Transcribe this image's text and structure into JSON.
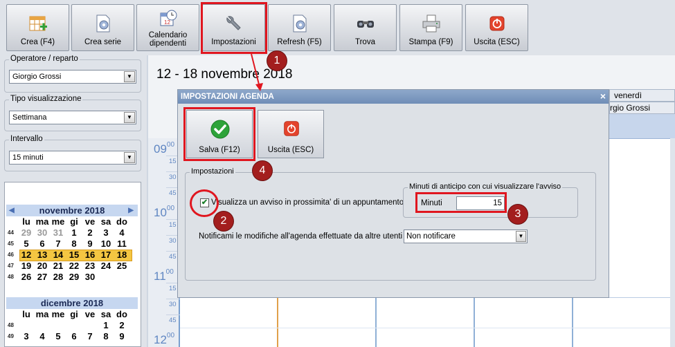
{
  "toolbar": {
    "buttons": [
      {
        "label": "Crea (F4)",
        "icon": "calendar-add-icon"
      },
      {
        "label": "Crea serie",
        "icon": "document-gear-icon"
      },
      {
        "label_line1": "Calendario",
        "label_line2": "dipendenti",
        "icon": "calendar-clock-icon"
      },
      {
        "label": "Impostazioni",
        "icon": "wrench-icon"
      },
      {
        "label": "Refresh (F5)",
        "icon": "document-gear-icon"
      },
      {
        "label": "Trova",
        "icon": "binoculars-icon"
      },
      {
        "label": "Stampa (F9)",
        "icon": "printer-icon"
      },
      {
        "label": "Uscita (ESC)",
        "icon": "power-icon"
      }
    ]
  },
  "left": {
    "operator_label": "Operatore / reparto",
    "operator_value": "Giorgio Grossi",
    "view_label": "Tipo visualizzazione",
    "view_value": "Settimana",
    "interval_label": "Intervallo",
    "interval_value": "15 minuti"
  },
  "calendar1": {
    "title": "novembre 2018",
    "days": [
      "lu",
      "ma",
      "me",
      "gi",
      "ve",
      "sa",
      "do"
    ],
    "weeks": [
      {
        "wk": "44",
        "d": [
          "29",
          "30",
          "31",
          "1",
          "2",
          "3",
          "4"
        ]
      },
      {
        "wk": "45",
        "d": [
          "5",
          "6",
          "7",
          "8",
          "9",
          "10",
          "11"
        ]
      },
      {
        "wk": "46",
        "d": [
          "12",
          "13",
          "14",
          "15",
          "16",
          "17",
          "18"
        ]
      },
      {
        "wk": "47",
        "d": [
          "19",
          "20",
          "21",
          "22",
          "23",
          "24",
          "25"
        ]
      },
      {
        "wk": "48",
        "d": [
          "26",
          "27",
          "28",
          "29",
          "30",
          "",
          ""
        ]
      }
    ]
  },
  "calendar2": {
    "title": "dicembre 2018",
    "days": [
      "lu",
      "ma",
      "me",
      "gi",
      "ve",
      "sa",
      "do"
    ],
    "weeks": [
      {
        "wk": "48",
        "d": [
          "",
          "",
          "",
          "",
          "",
          "1",
          "2"
        ]
      },
      {
        "wk": "49",
        "d": [
          "3",
          "4",
          "5",
          "6",
          "7",
          "8",
          "9"
        ]
      }
    ]
  },
  "main": {
    "date_range": "12 - 18 novembre 2018",
    "day_header": "venerdì",
    "operator_header": "rgio Grossi",
    "hours": [
      "09",
      "10",
      "11",
      "12"
    ],
    "hour_suffix": "00",
    "minutes": [
      "15",
      "30",
      "45"
    ]
  },
  "dialog": {
    "title": "IMPOSTAZIONI AGENDA",
    "close": "×",
    "save_label": "Salva (F12)",
    "exit_label": "Uscita (ESC)",
    "group_label": "Impostazioni",
    "checkbox_label": "Visualizza un avviso in prossimita' di un appuntamento",
    "checkbox_checked": true,
    "minutes_group_label": "Minuti di anticipo con cui visualizzare l'avviso",
    "minutes_label": "Minuti",
    "minutes_value": "15",
    "notify_label": "Notificami le modifiche all'agenda effettuate da altre utenti :",
    "notify_value": "Non notificare"
  },
  "annotations": [
    "1",
    "2",
    "3",
    "4"
  ],
  "colors": {
    "highlight": "#e0161f",
    "badge": "#a31e1e",
    "week_highlight": "#f4c642",
    "accent": "#5f86c2"
  }
}
